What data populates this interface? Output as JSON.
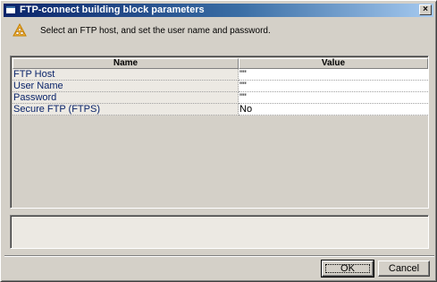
{
  "window": {
    "title": "FTP-connect building block parameters",
    "close_glyph": "×"
  },
  "info": {
    "icon": "warning-triangle-icon",
    "text": "Select an FTP host, and set the user name and password."
  },
  "grid": {
    "columns": [
      "Name",
      "Value"
    ],
    "rows": [
      {
        "name": "FTP Host",
        "value": "\"\""
      },
      {
        "name": "User Name",
        "value": "\"\""
      },
      {
        "name": "Password",
        "value": "\"\""
      },
      {
        "name": "Secure FTP (FTPS)",
        "value": "No"
      }
    ]
  },
  "description": "",
  "buttons": {
    "ok": "OK",
    "cancel": "Cancel"
  },
  "colors": {
    "title_gradient_start": "#0a246a",
    "title_gradient_end": "#a6caf0",
    "property_name": "#0a246a",
    "dialog_face": "#d4d0c8"
  }
}
